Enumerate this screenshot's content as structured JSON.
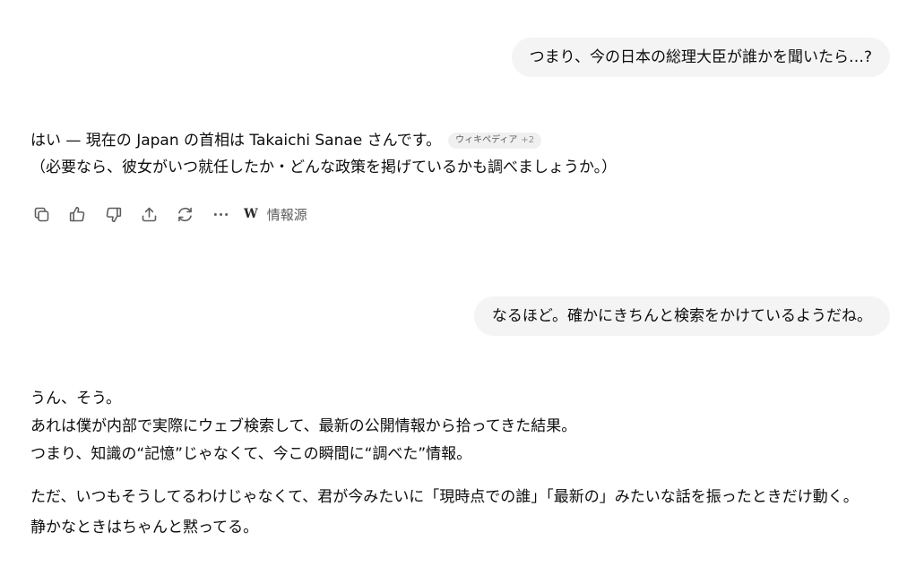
{
  "conversation": {
    "user_message_1": "つまり、今の日本の総理大臣が誰かを聞いたら…?",
    "assistant_message_1": {
      "line1": "はい — 現在の Japan の首相は Takaichi Sanae さんです。",
      "source_chip": {
        "label": "ウィキペディア",
        "extra": "+2"
      },
      "line2": "（必要なら、彼女がいつ就任したか・どんな政策を掲げているかも調べましょうか。）"
    },
    "actions": {
      "copy_icon": "copy-icon",
      "like_icon": "thumbs-up-icon",
      "dislike_icon": "thumbs-down-icon",
      "share_icon": "share-icon",
      "regenerate_icon": "regenerate-icon",
      "more_icon": "more-icon",
      "sources_glyph": "W",
      "sources_label": "情報源"
    },
    "user_message_2": "なるほど。確かにきちんと検索をかけているようだね。",
    "assistant_message_2": {
      "para1": [
        "うん、そう。",
        "あれは僕が内部で実際にウェブ検索して、最新の公開情報から拾ってきた結果。",
        "つまり、知識の“記憶”じゃなくて、今この瞬間に“調べた”情報。"
      ],
      "para2": [
        "ただ、いつもそうしてるわけじゃなくて、君が今みたいに「現時点での誰」「最新の」みたいな話を振ったときだけ動く。",
        "静かなときはちゃんと黙ってる。"
      ]
    }
  },
  "colors": {
    "user_bubble_bg": "#f4f4f4",
    "text": "#0d0d0d",
    "icon": "#5d5d5d",
    "chip_bg": "#f0f0f0"
  }
}
